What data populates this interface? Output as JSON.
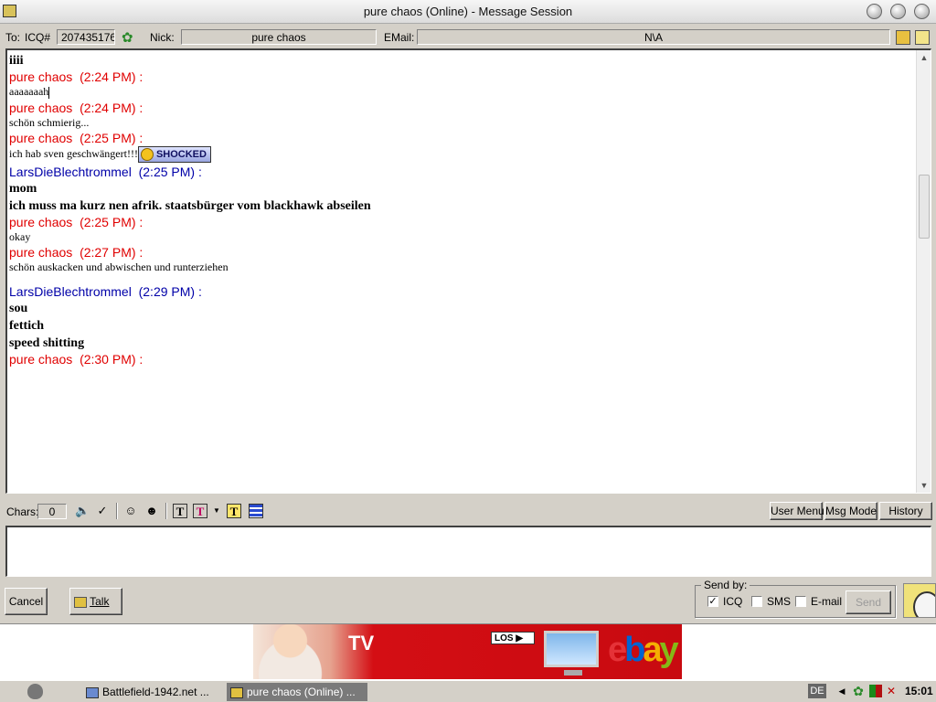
{
  "window": {
    "title": "pure chaos (Online) - Message Session"
  },
  "header": {
    "to_label": "To:",
    "icq_label": "ICQ#",
    "icq_number": "207435176",
    "nick_label": "Nick:",
    "nick_value": "pure chaos",
    "email_label": "EMail:",
    "email_value": "N\\A"
  },
  "conversation": [
    {
      "kind": "line",
      "text": "iiii",
      "style": "bold"
    },
    {
      "kind": "head",
      "sender": "pure chaos",
      "time": "(2:24 PM)",
      "color": "#e00000"
    },
    {
      "kind": "line",
      "text": "aaaaaaah",
      "style": "small",
      "cursor": true
    },
    {
      "kind": "head",
      "sender": "pure chaos",
      "time": "(2:24 PM)",
      "color": "#e00000"
    },
    {
      "kind": "line",
      "text": "schön schmierig...",
      "style": "small"
    },
    {
      "kind": "head",
      "sender": "pure chaos",
      "time": "(2:25 PM)",
      "color": "#e00000"
    },
    {
      "kind": "line",
      "text": "ich hab sven geschwängert!!!",
      "style": "small",
      "emoticon": "SHOCKED"
    },
    {
      "kind": "head",
      "sender": "LarsDieBlechtrommel",
      "time": "(2:25 PM)",
      "color": "#0000a8"
    },
    {
      "kind": "line",
      "text": "mom",
      "style": "bold"
    },
    {
      "kind": "line",
      "text": "ich muss ma kurz nen afrik. staatsbürger vom blackhawk abseilen",
      "style": "bold"
    },
    {
      "kind": "head",
      "sender": "pure chaos",
      "time": "(2:25 PM)",
      "color": "#e00000"
    },
    {
      "kind": "line",
      "text": "okay",
      "style": "small"
    },
    {
      "kind": "head",
      "sender": "pure chaos",
      "time": "(2:27 PM)",
      "color": "#e00000"
    },
    {
      "kind": "line",
      "text": "schön auskacken und abwischen und runterziehen",
      "style": "small"
    },
    {
      "kind": "gap"
    },
    {
      "kind": "head",
      "sender": "LarsDieBlechtrommel",
      "time": "(2:29 PM)",
      "color": "#0000a8"
    },
    {
      "kind": "line",
      "text": "sou",
      "style": "bold"
    },
    {
      "kind": "line",
      "text": "fettich",
      "style": "bold"
    },
    {
      "kind": "line",
      "text": "speed shitting",
      "style": "bold"
    },
    {
      "kind": "head",
      "sender": "pure chaos",
      "time": "(2:30 PM)",
      "color": "#e00000"
    }
  ],
  "toolbar": {
    "chars_label": "Chars:",
    "chars_value": "0",
    "user_menu": "User Menu",
    "msg_mode": "Msg Mode",
    "history": "History"
  },
  "compose": {
    "value": ""
  },
  "actions": {
    "cancel": "Cancel",
    "talk": "Talk"
  },
  "send_by": {
    "legend": "Send by:",
    "icq_label": "ICQ",
    "icq_checked": true,
    "sms_label": "SMS",
    "sms_checked": false,
    "email_label": "E-mail",
    "email_checked": false,
    "send_button": "Send"
  },
  "ad": {
    "tv_text": "TV",
    "los_text": "LOS ▶",
    "brand_letters": [
      "e",
      "b",
      "a",
      "y"
    ],
    "brand_colors": [
      "#e53238",
      "#0064d2",
      "#f5af02",
      "#86b817"
    ]
  },
  "taskbar": {
    "tasks": [
      {
        "label": "Battlefield-1942.net ...",
        "active": false
      },
      {
        "label": "pure chaos (Online) ...",
        "active": true
      }
    ],
    "language": "DE",
    "clock": "15:01"
  }
}
